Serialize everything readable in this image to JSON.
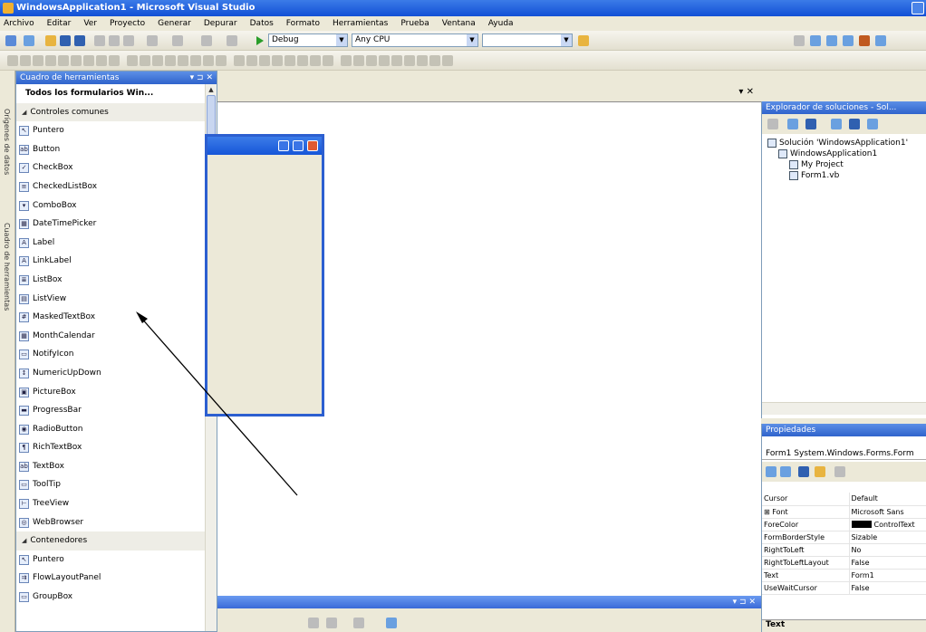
{
  "window": {
    "title": "WindowsApplication1 - Microsoft Visual Studio"
  },
  "menu": [
    "Archivo",
    "Editar",
    "Ver",
    "Proyecto",
    "Generar",
    "Depurar",
    "Datos",
    "Formato",
    "Herramientas",
    "Prueba",
    "Ventana",
    "Ayuda"
  ],
  "toolbar": {
    "config": "Debug",
    "platform": "Any CPU"
  },
  "toolbox": {
    "title": "Cuadro de herramientas",
    "controls": "▾ ⊐ ✕",
    "items": [
      {
        "type": "group-top",
        "label": "Todos los formularios Win..."
      },
      {
        "type": "group",
        "label": "Controles comunes"
      },
      {
        "type": "item",
        "label": "Puntero",
        "icon": "pointer-icon",
        "glyph": "↖"
      },
      {
        "type": "item",
        "label": "Button",
        "icon": "button-icon",
        "glyph": "ab"
      },
      {
        "type": "item",
        "label": "CheckBox",
        "icon": "checkbox-icon",
        "glyph": "✓"
      },
      {
        "type": "item",
        "label": "CheckedListBox",
        "icon": "checkedlistbox-icon",
        "glyph": "≡"
      },
      {
        "type": "item",
        "label": "ComboBox",
        "icon": "combobox-icon",
        "glyph": "▾"
      },
      {
        "type": "item",
        "label": "DateTimePicker",
        "icon": "datetimepicker-icon",
        "glyph": "▦"
      },
      {
        "type": "item",
        "label": "Label",
        "icon": "label-icon",
        "glyph": "A"
      },
      {
        "type": "item",
        "label": "LinkLabel",
        "icon": "linklabel-icon",
        "glyph": "A"
      },
      {
        "type": "item",
        "label": "ListBox",
        "icon": "listbox-icon",
        "glyph": "≣"
      },
      {
        "type": "item",
        "label": "ListView",
        "icon": "listview-icon",
        "glyph": "▤"
      },
      {
        "type": "item",
        "label": "MaskedTextBox",
        "icon": "maskedtextbox-icon",
        "glyph": "#"
      },
      {
        "type": "item",
        "label": "MonthCalendar",
        "icon": "monthcalendar-icon",
        "glyph": "▦"
      },
      {
        "type": "item",
        "label": "NotifyIcon",
        "icon": "notifyicon-icon",
        "glyph": "▭"
      },
      {
        "type": "item",
        "label": "NumericUpDown",
        "icon": "numericupdown-icon",
        "glyph": "↕"
      },
      {
        "type": "item",
        "label": "PictureBox",
        "icon": "picturebox-icon",
        "glyph": "▣"
      },
      {
        "type": "item",
        "label": "ProgressBar",
        "icon": "progressbar-icon",
        "glyph": "▬"
      },
      {
        "type": "item",
        "label": "RadioButton",
        "icon": "radiobutton-icon",
        "glyph": "◉"
      },
      {
        "type": "item",
        "label": "RichTextBox",
        "icon": "richtextbox-icon",
        "glyph": "¶"
      },
      {
        "type": "item",
        "label": "TextBox",
        "icon": "textbox-icon",
        "glyph": "ab"
      },
      {
        "type": "item",
        "label": "ToolTip",
        "icon": "tooltip-icon",
        "glyph": "▭"
      },
      {
        "type": "item",
        "label": "TreeView",
        "icon": "treeview-icon",
        "glyph": "⊢"
      },
      {
        "type": "item",
        "label": "WebBrowser",
        "icon": "webbrowser-icon",
        "glyph": "◎"
      },
      {
        "type": "group",
        "label": "Contenedores"
      },
      {
        "type": "item",
        "label": "Puntero",
        "icon": "pointer-icon",
        "glyph": "↖"
      },
      {
        "type": "item",
        "label": "FlowLayoutPanel",
        "icon": "flowlayoutpanel-icon",
        "glyph": "⇉"
      },
      {
        "type": "item",
        "label": "GroupBox",
        "icon": "groupbox-icon",
        "glyph": "▭"
      }
    ]
  },
  "strip": {
    "label1": "Orígenes de datos",
    "label2": "Cuadro de herramientas"
  },
  "solution_explorer": {
    "title": "Explorador de soluciones - Sol...",
    "tree": [
      {
        "label": "Solución 'WindowsApplication1'",
        "indent": 0
      },
      {
        "label": "WindowsApplication1",
        "indent": 1
      },
      {
        "label": "My Project",
        "indent": 2
      },
      {
        "label": "Form1.vb",
        "indent": 2
      }
    ]
  },
  "properties": {
    "title": "Propiedades",
    "object": "Form1 System.Windows.Forms.Form",
    "rows": [
      {
        "name": "Cursor",
        "value": "Default"
      },
      {
        "name": "⊞ Font",
        "value": "Microsoft Sans"
      },
      {
        "name": "ForeColor",
        "value": "ControlText"
      },
      {
        "name": "FormBorderStyle",
        "value": "Sizable"
      },
      {
        "name": "RightToLeft",
        "value": "No"
      },
      {
        "name": "RightToLeftLayout",
        "value": "False"
      },
      {
        "name": "Text",
        "value": "Form1"
      },
      {
        "name": "UseWaitCursor",
        "value": "False"
      }
    ],
    "description": "Text"
  }
}
